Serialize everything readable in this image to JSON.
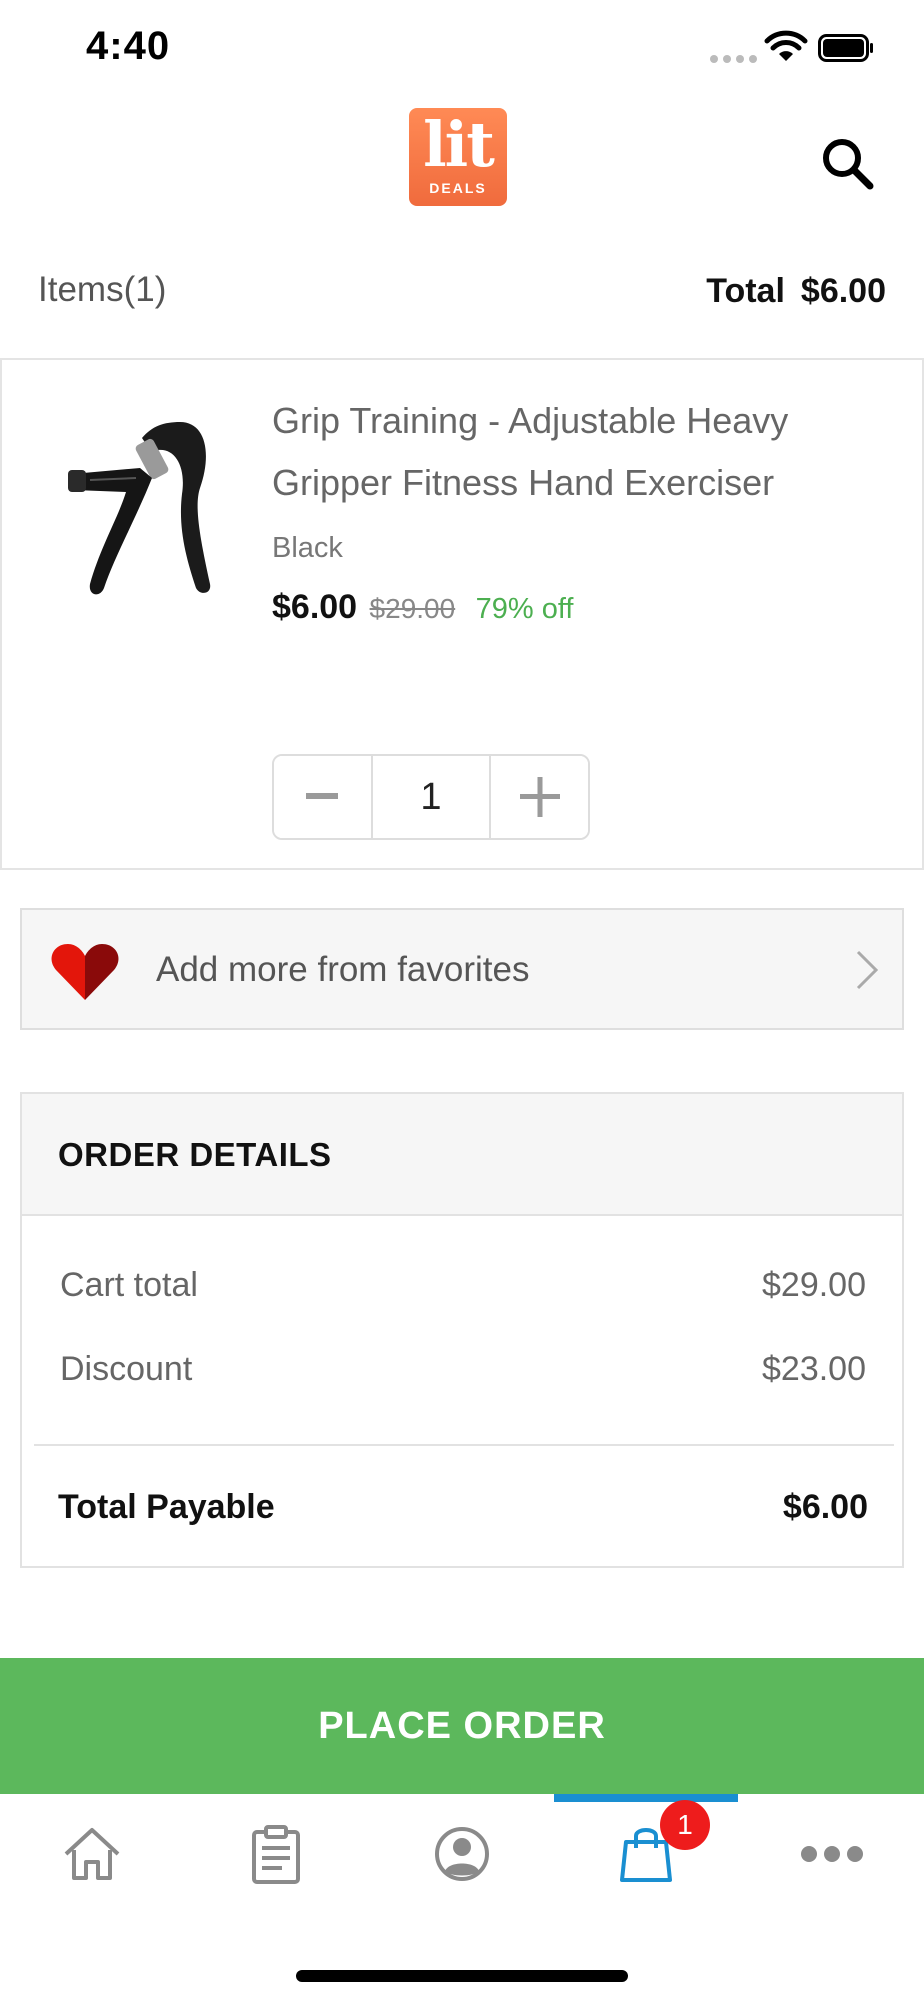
{
  "status_bar": {
    "time": "4:40"
  },
  "header": {
    "logo_main": "lit",
    "logo_sub": "DEALS",
    "search_icon": "search-icon"
  },
  "summary": {
    "items_label": "Items(1)",
    "total_label": "Total",
    "total_value": "$6.00"
  },
  "product": {
    "name": "Grip Training - Adjustable Heavy Gripper Fitness Hand Exerciser",
    "variant": "Black",
    "price": "$6.00",
    "original_price": "$29.00",
    "discount": "79% off",
    "quantity": "1",
    "minus_icon": "minus-icon",
    "plus_icon": "plus-icon"
  },
  "favorites": {
    "label": "Add more from favorites",
    "icon": "heart-icon"
  },
  "order_details": {
    "title": "ORDER DETAILS",
    "rows": [
      {
        "label": "Cart total",
        "value": "$29.00"
      },
      {
        "label": "Discount",
        "value": "$23.00"
      }
    ],
    "total_label": "Total Payable",
    "total_value": "$6.00"
  },
  "place_order": {
    "label": "PLACE ORDER"
  },
  "tabbar": {
    "tabs": [
      "home-icon",
      "orders-icon",
      "profile-icon",
      "cart-icon",
      "more-icon"
    ],
    "active": "cart-icon",
    "cart_badge": "1",
    "accent": "#1a8fd1"
  },
  "colors": {
    "place_order": "#5cb85c",
    "discount_text": "#4caf50",
    "logo": "#f47a49",
    "badge": "#ee1c1c"
  }
}
